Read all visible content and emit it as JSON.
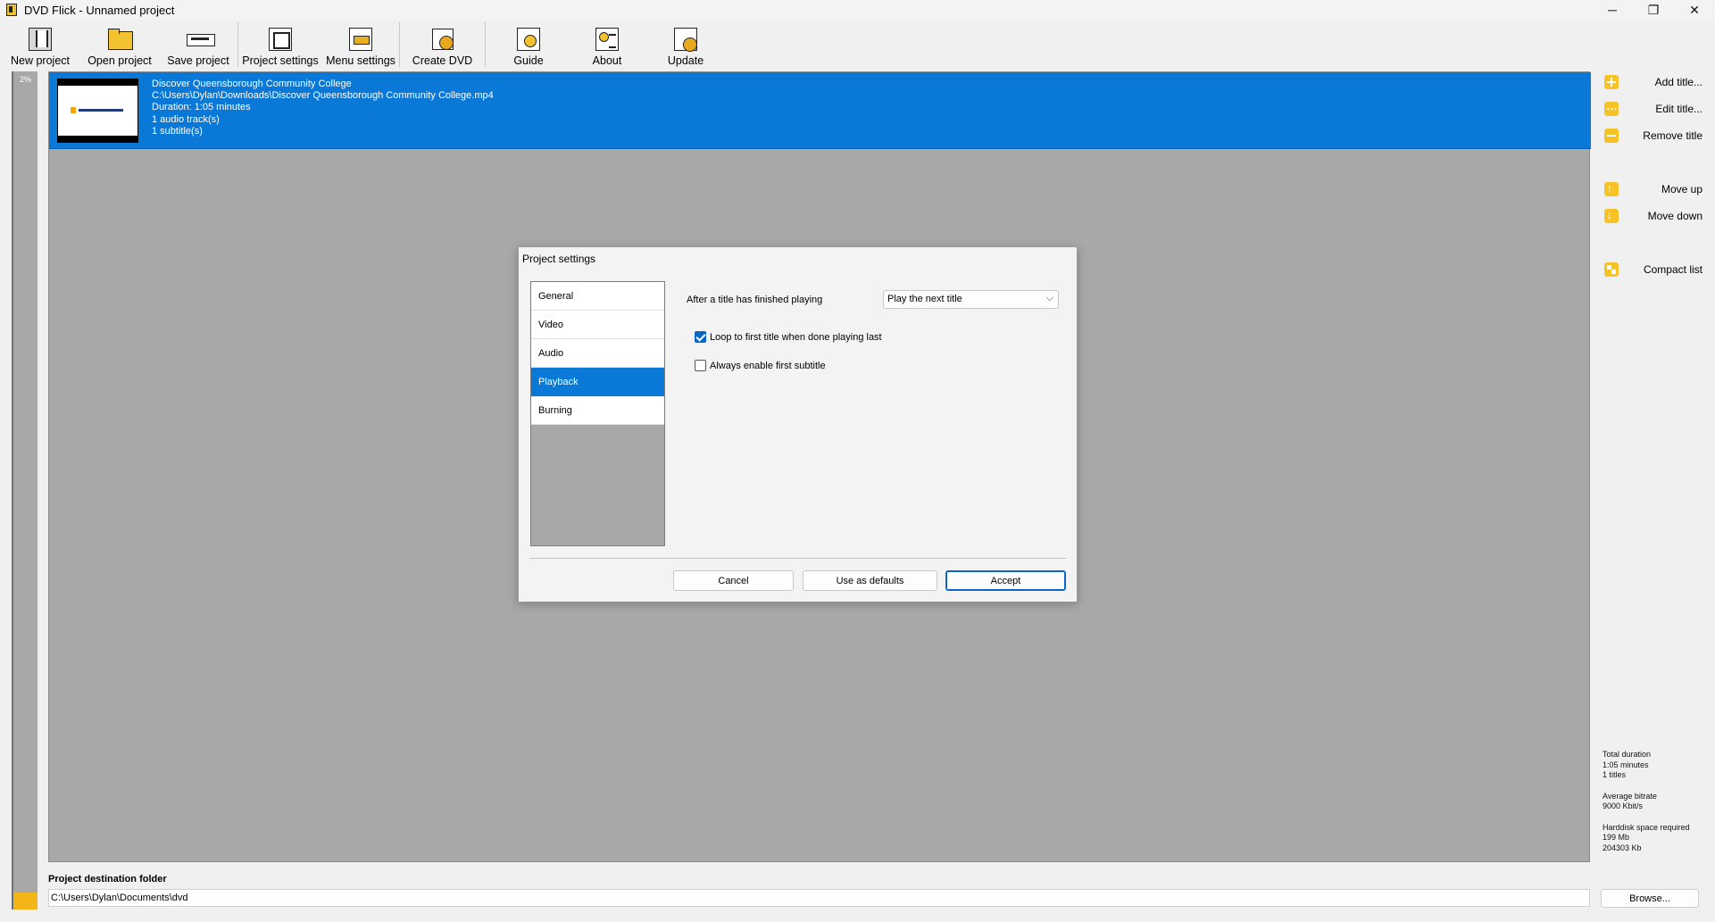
{
  "window": {
    "title": "DVD Flick - Unnamed project",
    "controls": {
      "minimize": "─",
      "restore": "❐",
      "close": "✕"
    }
  },
  "toolbar": {
    "new_project": "New project",
    "open_project": "Open project",
    "save_project": "Save project",
    "project_settings": "Project settings",
    "menu_settings": "Menu settings",
    "create_dvd": "Create DVD",
    "guide": "Guide",
    "about": "About",
    "update": "Update"
  },
  "progress": {
    "label": "2%",
    "value": 0.02
  },
  "titles": [
    {
      "name": "Discover Queensborough Community College",
      "path": "C:\\Users\\Dylan\\Downloads\\Discover Queensborough Community College.mp4",
      "duration": "Duration: 1:05 minutes",
      "audio": "1 audio track(s)",
      "subtitles": "1 subtitle(s)"
    }
  ],
  "actions": {
    "add_title": "Add title...",
    "edit_title": "Edit title...",
    "remove_title": "Remove title",
    "move_up": "Move up",
    "move_down": "Move down",
    "compact_list": "Compact list"
  },
  "stats": {
    "total_duration_label": "Total duration",
    "total_duration_value": "1:05 minutes",
    "titles_count": "1 titles",
    "avg_bitrate_label": "Average bitrate",
    "avg_bitrate_value": "9000 Kbit/s",
    "harddisk_label": "Harddisk space required",
    "harddisk_mb": "199 Mb",
    "harddisk_kb": "204303 Kb"
  },
  "destination": {
    "label": "Project destination folder",
    "path": "C:\\Users\\Dylan\\Documents\\dvd",
    "browse": "Browse..."
  },
  "dialog": {
    "title": "Project settings",
    "nav": [
      "General",
      "Video",
      "Audio",
      "Playback",
      "Burning"
    ],
    "active_nav": "Playback",
    "after_title_label": "After a title has finished playing",
    "after_title_value": "Play the next title",
    "loop_label": "Loop to first title when done playing last",
    "loop_checked": true,
    "subtitle_label": "Always enable first subtitle",
    "subtitle_checked": false,
    "cancel": "Cancel",
    "use_defaults": "Use as defaults",
    "accept": "Accept"
  },
  "colors": {
    "accent": "#0a78d6",
    "panel_gray": "#a8a8a8",
    "action_icon": "#f5c326",
    "progress": "#f2b619"
  }
}
